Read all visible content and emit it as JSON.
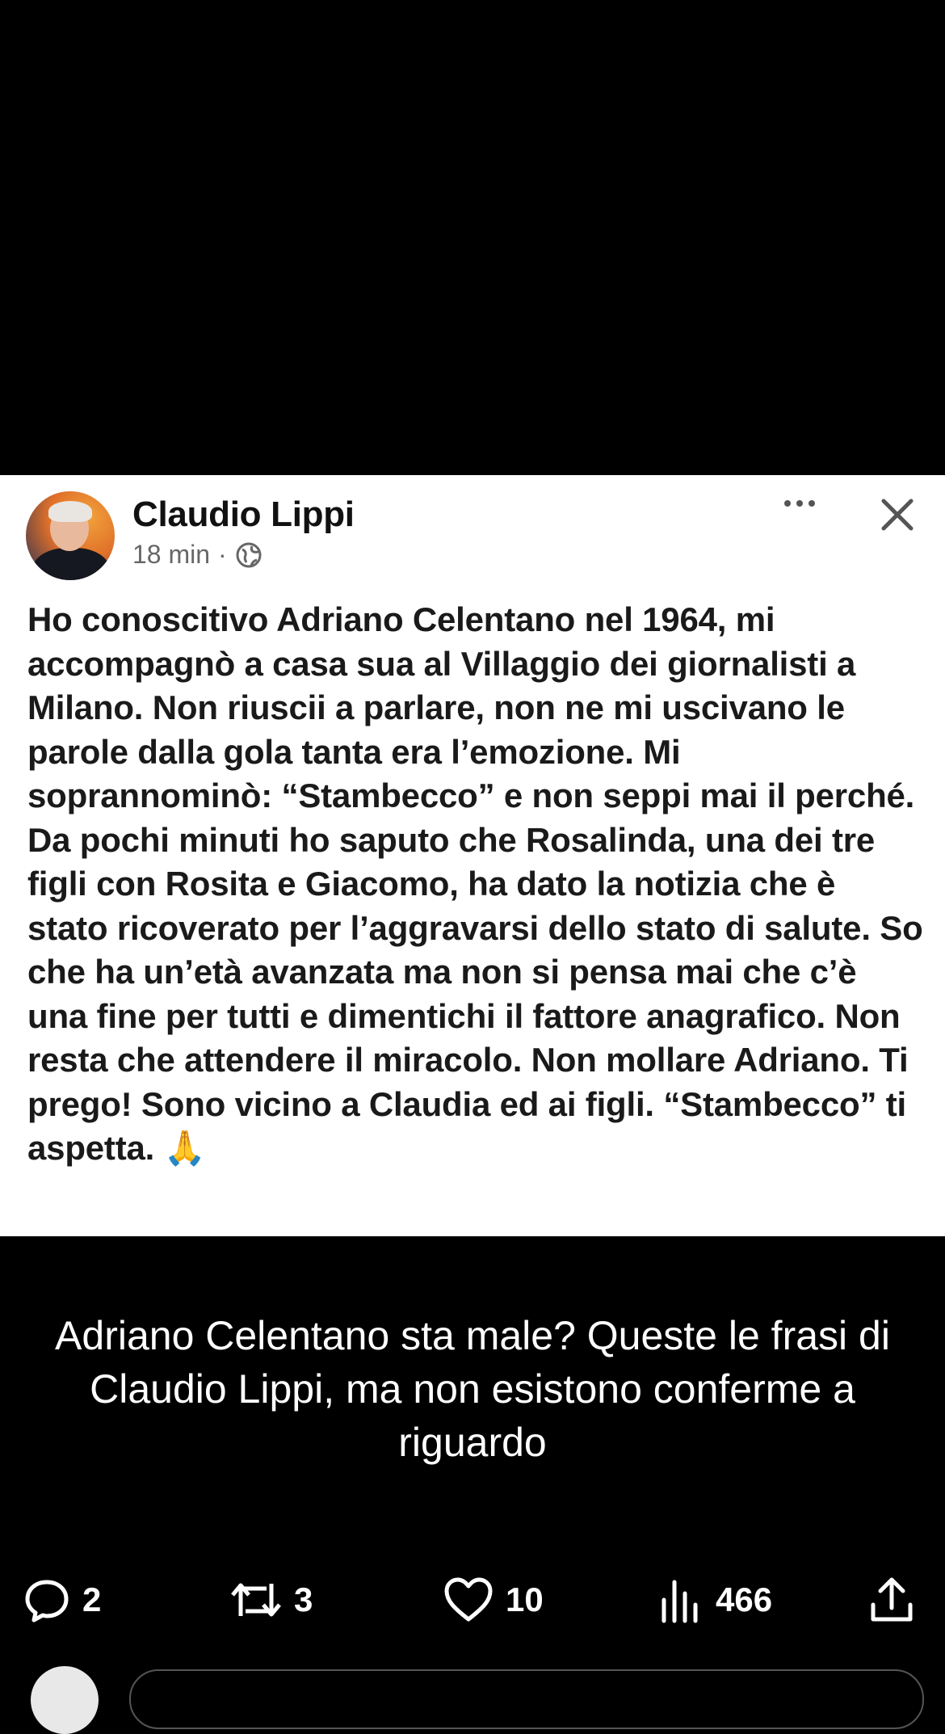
{
  "post": {
    "author_name": "Claudio Lippi",
    "time": "18 min",
    "separator": "·",
    "audience_icon": "globe-icon",
    "more_icon": "more-icon",
    "close_icon": "close-icon",
    "text": "Ho conoscitivo Adriano Celentano nel 1964, mi accompagnò a casa sua al Villaggio dei giornalisti a Milano. Non riuscii a parlare, non ne mi uscivano le parole dalla gola tanta era l’emozione. Mi soprannominò: “Stambecco” e non seppi mai il perché. Da pochi minuti ho saputo che Rosalinda, una dei tre figli con Rosita e Giacomo, ha dato la notizia che è stato ricoverato per l’aggravarsi dello stato di salute. So che ha un’età avanzata ma non si pensa mai che c’è una fine per tutti e dimentichi il fattore anagrafico. Non resta che attendere il miracolo. Non mollare Adriano. Ti prego! Sono vicino a Claudia ed ai figli. “Stambecco” ti aspetta.",
    "emoji": "🙏"
  },
  "caption": "Adriano Celentano sta male? Queste le frasi di Claudio Lippi, ma non esistono conferme a riguardo",
  "actions": {
    "replies": "2",
    "reposts": "3",
    "likes": "10",
    "views": "466"
  },
  "colors": {
    "background": "#000000",
    "card": "#ffffff",
    "text_dark": "#111111",
    "meta_gray": "#666666"
  }
}
